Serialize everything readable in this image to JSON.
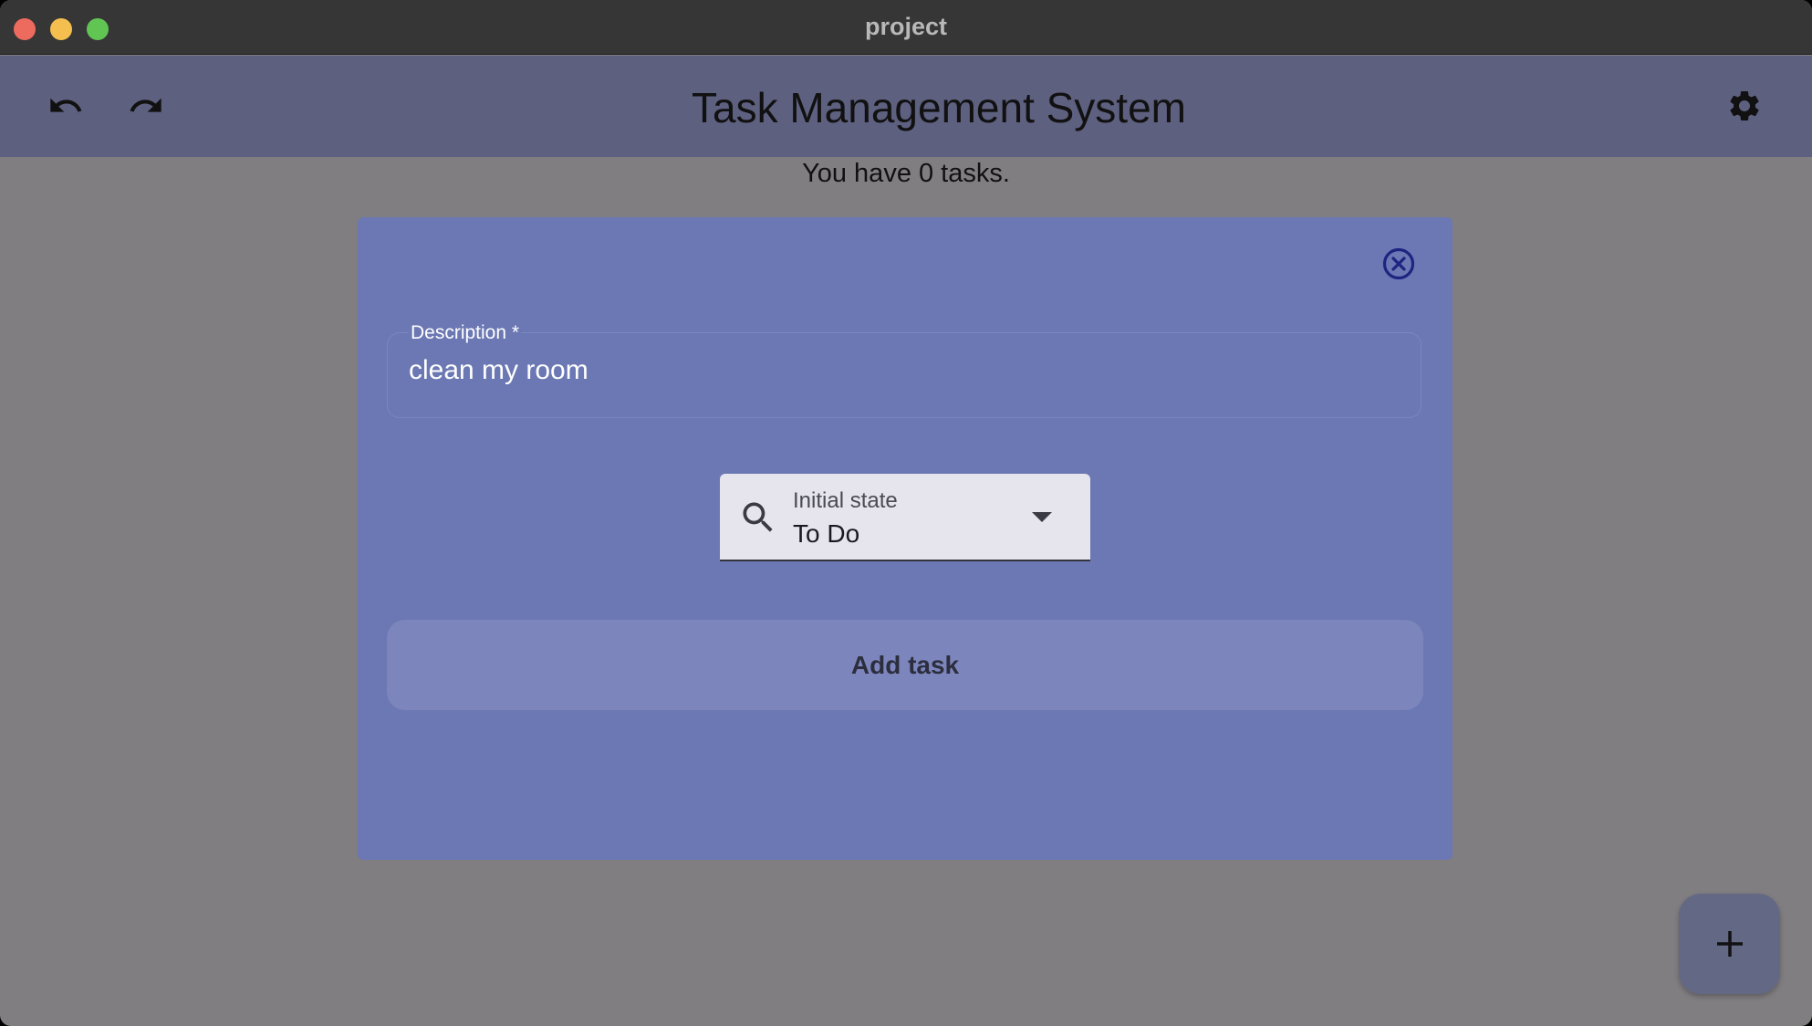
{
  "window": {
    "title": "project"
  },
  "appbar": {
    "title": "Task Management System",
    "undo_icon": "undo-icon",
    "redo_icon": "redo-icon",
    "settings_icon": "gear-icon"
  },
  "main": {
    "task_count_text": "You have 0 tasks."
  },
  "dialog": {
    "close_icon": "close-circle-icon",
    "description": {
      "label": "Description *",
      "value": "clean my room"
    },
    "initial_state": {
      "label": "Initial state",
      "value": "To Do",
      "icon": "search-icon"
    },
    "add_button_label": "Add task"
  },
  "fab": {
    "icon": "plus-icon"
  },
  "colors": {
    "titlebar": "#363636",
    "appbar": "#5e6080",
    "scrim": "#807e81",
    "dialog": "#6b78b3",
    "button": "#7c86bd",
    "fab": "#636985"
  }
}
